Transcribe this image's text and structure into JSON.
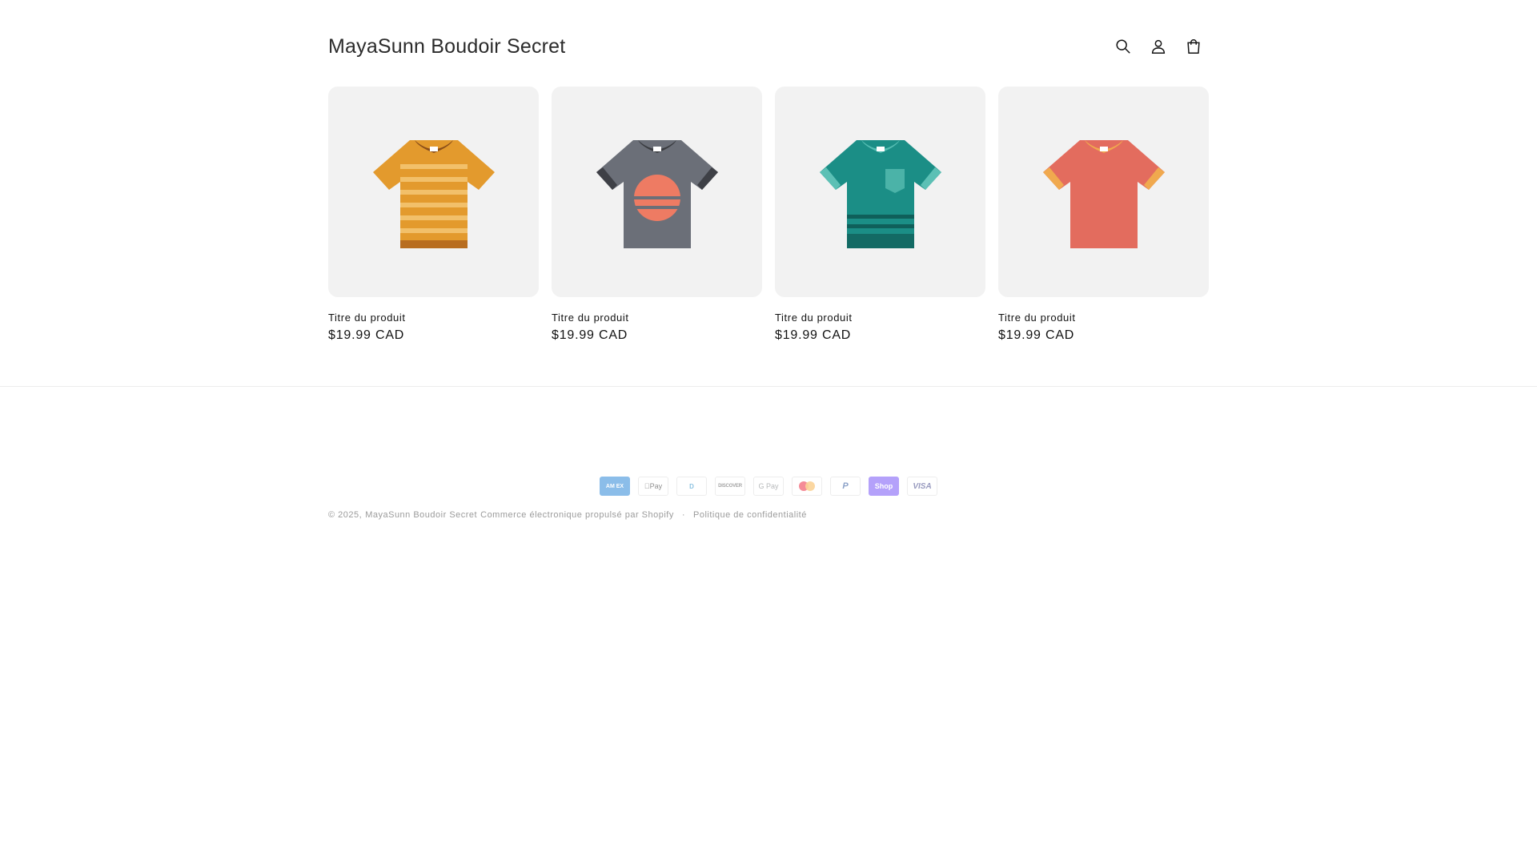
{
  "header": {
    "store_name": "MayaSunn Boudoir Secret",
    "icons": [
      "search-icon",
      "account-icon",
      "cart-icon"
    ]
  },
  "products": [
    {
      "title": "Titre du produit",
      "price": "$19.99 CAD",
      "shirt": "striped-orange"
    },
    {
      "title": "Titre du produit",
      "price": "$19.99 CAD",
      "shirt": "grey-sunset"
    },
    {
      "title": "Titre du produit",
      "price": "$19.99 CAD",
      "shirt": "teal-pocket"
    },
    {
      "title": "Titre du produit",
      "price": "$19.99 CAD",
      "shirt": "coral-plain"
    }
  ],
  "footer": {
    "payments": {
      "amex": "AM EX",
      "apple": "Pay",
      "diners": "D",
      "discover": "DISCOVER",
      "gpay": "G Pay",
      "paypal": "P",
      "shop": "Shop",
      "visa": "VISA"
    },
    "copyright_prefix": "© 2025,",
    "store_link": "MayaSunn Boudoir Secret",
    "powered_by": "Commerce électronique propulsé par Shopify",
    "separator": "·",
    "privacy": "Politique de confidentialité"
  },
  "colors": {
    "card_bg": "#f2f2f2",
    "text": "#121212",
    "orange": "#e09a2c",
    "grey": "#6b6f78",
    "teal": "#1a8c84",
    "coral": "#e36b5d"
  }
}
